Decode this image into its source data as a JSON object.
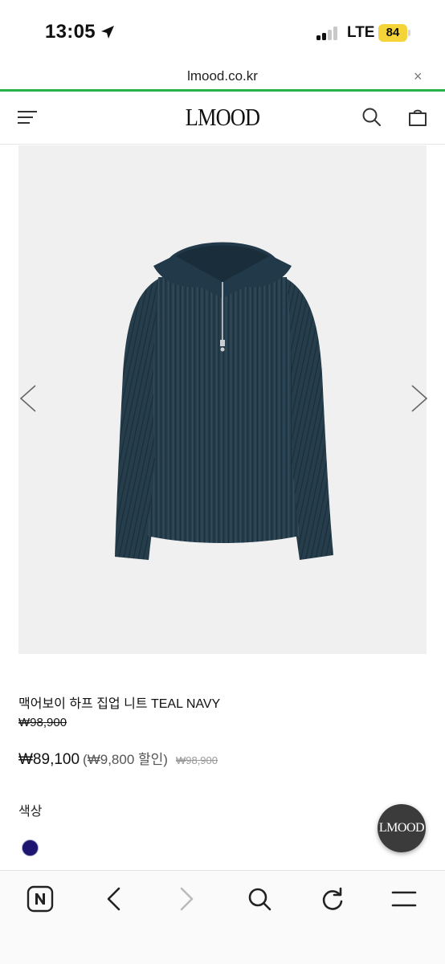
{
  "status_bar": {
    "time": "13:05",
    "network": "LTE",
    "battery": "84",
    "battery_color": "#f5d43a"
  },
  "browser": {
    "url": "lmood.co.kr",
    "close_glyph": "×",
    "progress_color": "#26b14a",
    "load_progress": 1.0
  },
  "header": {
    "logo": "LMOOD",
    "menu_icon": "hamburger-menu-icon",
    "search_icon": "search-icon",
    "bag_icon": "shopping-bag-icon"
  },
  "product": {
    "image_icon": "half-zip-knit-sweater",
    "prev_icon": "chevron-left-icon",
    "next_icon": "chevron-right-icon",
    "name": "맥어보이 하프 집업 니트 TEAL NAVY",
    "original_price": "₩98,900",
    "sale_price": "₩89,100",
    "discount_text": "(₩9,800 할인)",
    "struck_price": "₩98,900",
    "color_label": "색상",
    "color_swatch": "#1c1670"
  },
  "floating_button": {
    "label": "LMOOD"
  },
  "toolbar": {
    "icons": [
      "naver-icon",
      "back-icon",
      "forward-icon",
      "search-icon",
      "reload-icon",
      "menu-icon"
    ]
  }
}
